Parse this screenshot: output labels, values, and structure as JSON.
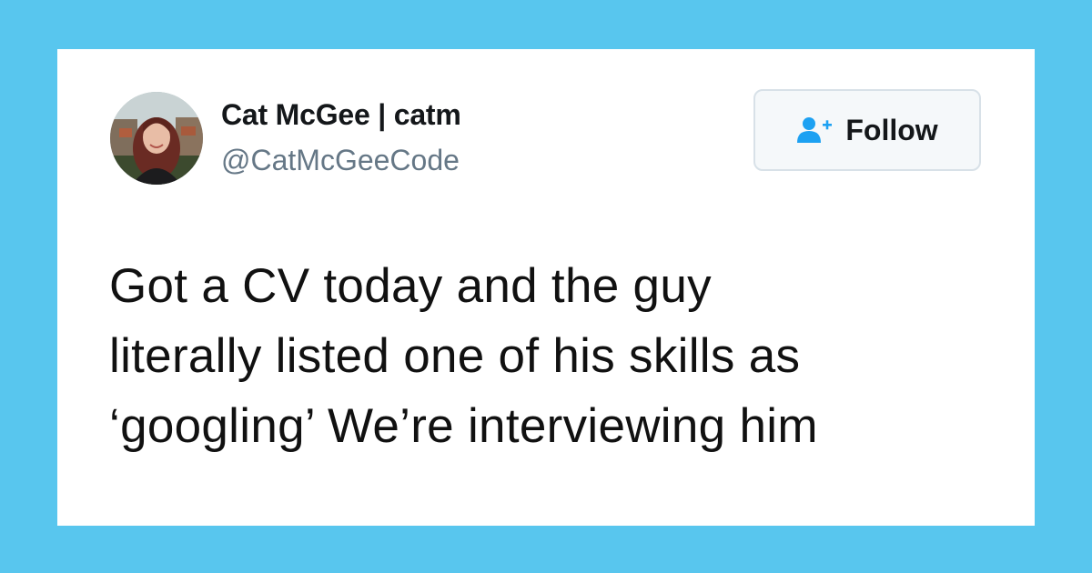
{
  "user": {
    "display_name": "Cat McGee | catm",
    "handle": "@CatMcGeeCode"
  },
  "follow_button": {
    "label": "Follow",
    "icon": "add-user-icon"
  },
  "tweet": {
    "lines": [
      "Got a CV today and the guy",
      "literally listed one of his skills as",
      "‘googling’ We’re interviewing him"
    ]
  },
  "colors": {
    "background": "#58c6ee",
    "card": "#ffffff",
    "follow_icon": "#1da1f2",
    "handle_text": "#657786"
  }
}
